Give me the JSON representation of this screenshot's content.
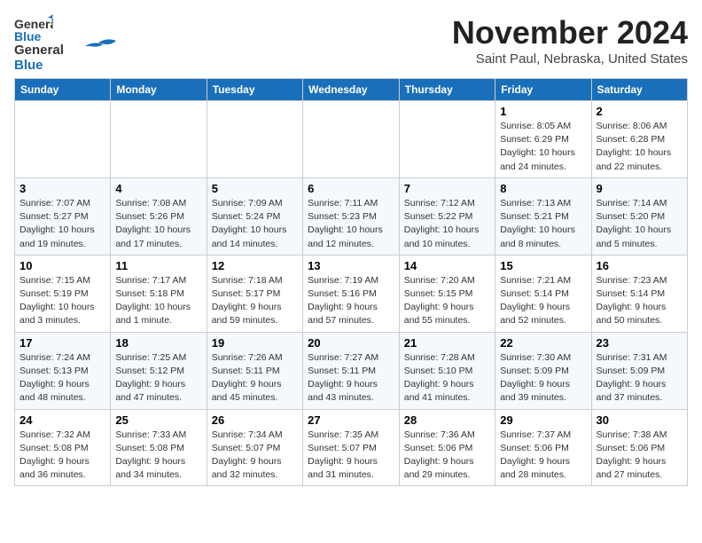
{
  "logo": {
    "line1": "General",
    "line2": "Blue"
  },
  "title": "November 2024",
  "subtitle": "Saint Paul, Nebraska, United States",
  "days_of_week": [
    "Sunday",
    "Monday",
    "Tuesday",
    "Wednesday",
    "Thursday",
    "Friday",
    "Saturday"
  ],
  "weeks": [
    [
      {
        "day": "",
        "info": ""
      },
      {
        "day": "",
        "info": ""
      },
      {
        "day": "",
        "info": ""
      },
      {
        "day": "",
        "info": ""
      },
      {
        "day": "",
        "info": ""
      },
      {
        "day": "1",
        "info": "Sunrise: 8:05 AM\nSunset: 6:29 PM\nDaylight: 10 hours and 24 minutes."
      },
      {
        "day": "2",
        "info": "Sunrise: 8:06 AM\nSunset: 6:28 PM\nDaylight: 10 hours and 22 minutes."
      }
    ],
    [
      {
        "day": "3",
        "info": "Sunrise: 7:07 AM\nSunset: 5:27 PM\nDaylight: 10 hours and 19 minutes."
      },
      {
        "day": "4",
        "info": "Sunrise: 7:08 AM\nSunset: 5:26 PM\nDaylight: 10 hours and 17 minutes."
      },
      {
        "day": "5",
        "info": "Sunrise: 7:09 AM\nSunset: 5:24 PM\nDaylight: 10 hours and 14 minutes."
      },
      {
        "day": "6",
        "info": "Sunrise: 7:11 AM\nSunset: 5:23 PM\nDaylight: 10 hours and 12 minutes."
      },
      {
        "day": "7",
        "info": "Sunrise: 7:12 AM\nSunset: 5:22 PM\nDaylight: 10 hours and 10 minutes."
      },
      {
        "day": "8",
        "info": "Sunrise: 7:13 AM\nSunset: 5:21 PM\nDaylight: 10 hours and 8 minutes."
      },
      {
        "day": "9",
        "info": "Sunrise: 7:14 AM\nSunset: 5:20 PM\nDaylight: 10 hours and 5 minutes."
      }
    ],
    [
      {
        "day": "10",
        "info": "Sunrise: 7:15 AM\nSunset: 5:19 PM\nDaylight: 10 hours and 3 minutes."
      },
      {
        "day": "11",
        "info": "Sunrise: 7:17 AM\nSunset: 5:18 PM\nDaylight: 10 hours and 1 minute."
      },
      {
        "day": "12",
        "info": "Sunrise: 7:18 AM\nSunset: 5:17 PM\nDaylight: 9 hours and 59 minutes."
      },
      {
        "day": "13",
        "info": "Sunrise: 7:19 AM\nSunset: 5:16 PM\nDaylight: 9 hours and 57 minutes."
      },
      {
        "day": "14",
        "info": "Sunrise: 7:20 AM\nSunset: 5:15 PM\nDaylight: 9 hours and 55 minutes."
      },
      {
        "day": "15",
        "info": "Sunrise: 7:21 AM\nSunset: 5:14 PM\nDaylight: 9 hours and 52 minutes."
      },
      {
        "day": "16",
        "info": "Sunrise: 7:23 AM\nSunset: 5:14 PM\nDaylight: 9 hours and 50 minutes."
      }
    ],
    [
      {
        "day": "17",
        "info": "Sunrise: 7:24 AM\nSunset: 5:13 PM\nDaylight: 9 hours and 48 minutes."
      },
      {
        "day": "18",
        "info": "Sunrise: 7:25 AM\nSunset: 5:12 PM\nDaylight: 9 hours and 47 minutes."
      },
      {
        "day": "19",
        "info": "Sunrise: 7:26 AM\nSunset: 5:11 PM\nDaylight: 9 hours and 45 minutes."
      },
      {
        "day": "20",
        "info": "Sunrise: 7:27 AM\nSunset: 5:11 PM\nDaylight: 9 hours and 43 minutes."
      },
      {
        "day": "21",
        "info": "Sunrise: 7:28 AM\nSunset: 5:10 PM\nDaylight: 9 hours and 41 minutes."
      },
      {
        "day": "22",
        "info": "Sunrise: 7:30 AM\nSunset: 5:09 PM\nDaylight: 9 hours and 39 minutes."
      },
      {
        "day": "23",
        "info": "Sunrise: 7:31 AM\nSunset: 5:09 PM\nDaylight: 9 hours and 37 minutes."
      }
    ],
    [
      {
        "day": "24",
        "info": "Sunrise: 7:32 AM\nSunset: 5:08 PM\nDaylight: 9 hours and 36 minutes."
      },
      {
        "day": "25",
        "info": "Sunrise: 7:33 AM\nSunset: 5:08 PM\nDaylight: 9 hours and 34 minutes."
      },
      {
        "day": "26",
        "info": "Sunrise: 7:34 AM\nSunset: 5:07 PM\nDaylight: 9 hours and 32 minutes."
      },
      {
        "day": "27",
        "info": "Sunrise: 7:35 AM\nSunset: 5:07 PM\nDaylight: 9 hours and 31 minutes."
      },
      {
        "day": "28",
        "info": "Sunrise: 7:36 AM\nSunset: 5:06 PM\nDaylight: 9 hours and 29 minutes."
      },
      {
        "day": "29",
        "info": "Sunrise: 7:37 AM\nSunset: 5:06 PM\nDaylight: 9 hours and 28 minutes."
      },
      {
        "day": "30",
        "info": "Sunrise: 7:38 AM\nSunset: 5:06 PM\nDaylight: 9 hours and 27 minutes."
      }
    ]
  ]
}
